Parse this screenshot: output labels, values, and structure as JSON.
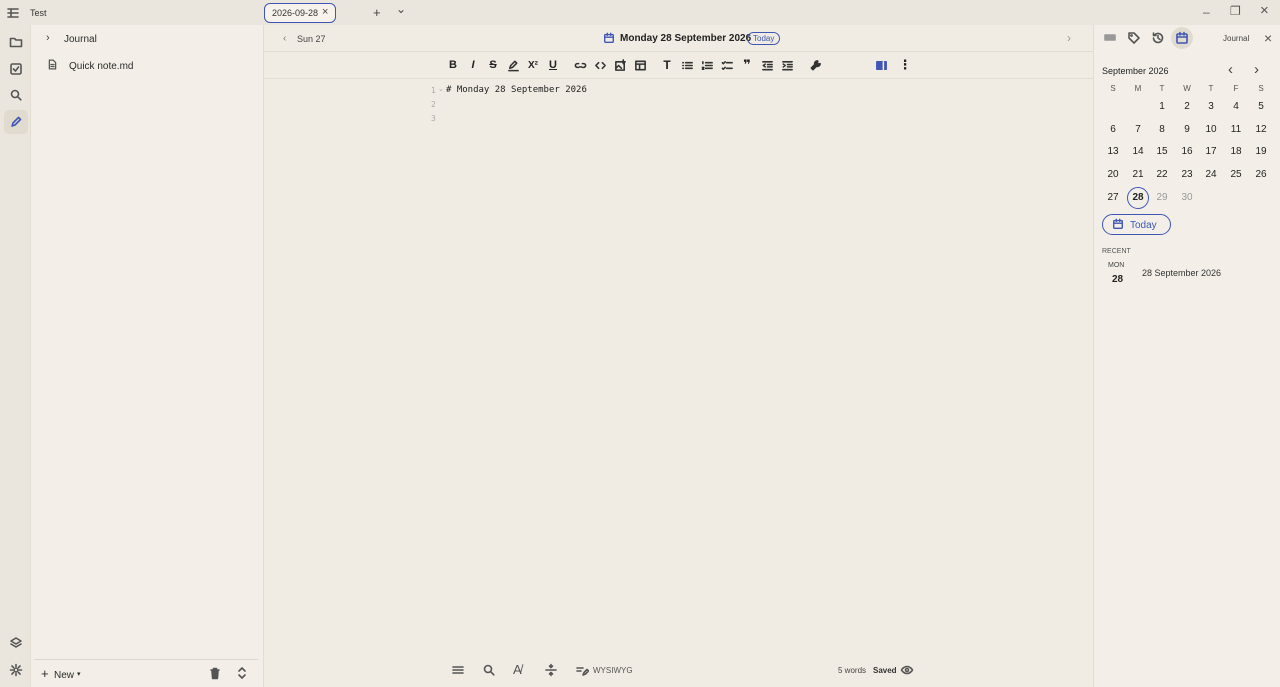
{
  "window": {
    "title": "Test"
  },
  "tabs": [
    {
      "label": "2026-09-28",
      "close": "×"
    }
  ],
  "tabbar": {
    "add": "+",
    "more": "⌄"
  },
  "window_controls": {
    "minimize": "–",
    "maximize": "❐",
    "close": "×"
  },
  "sidebar": {
    "items": [
      {
        "label": "Journal",
        "type": "folder"
      },
      {
        "label": "Quick note.md",
        "type": "file"
      }
    ],
    "new_label": "New"
  },
  "editor": {
    "prev_day": "Sun 27",
    "date_title": "Monday 28 September 2026",
    "today_badge": "Today",
    "lines": [
      {
        "num": "1",
        "text": "# Monday 28 September 2026"
      },
      {
        "num": "2",
        "text": ""
      },
      {
        "num": "3",
        "text": ""
      }
    ],
    "status": {
      "words": "5 words",
      "saved": "Saved",
      "mode": "WYSIWYG"
    }
  },
  "rpanel": {
    "title": "Journal",
    "month": "September 2026",
    "weekdays": [
      "S",
      "M",
      "T",
      "W",
      "T",
      "F",
      "S"
    ],
    "weeks": [
      [
        "",
        "",
        "1",
        "2",
        "3",
        "4",
        "5"
      ],
      [
        "6",
        "7",
        "8",
        "9",
        "10",
        "11",
        "12"
      ],
      [
        "13",
        "14",
        "15",
        "16",
        "17",
        "18",
        "19"
      ],
      [
        "20",
        "21",
        "22",
        "23",
        "24",
        "25",
        "26"
      ],
      [
        "27",
        "28",
        "29",
        "30",
        "",
        "",
        ""
      ]
    ],
    "today_button": "Today",
    "recent_label": "RECENT",
    "recent": [
      {
        "dow": "MON",
        "day": "28",
        "label": "28 September 2026"
      }
    ]
  },
  "colors": {
    "accent": "#3f56b5",
    "bg": "#f1ece3",
    "panel": "#f3efe8"
  }
}
